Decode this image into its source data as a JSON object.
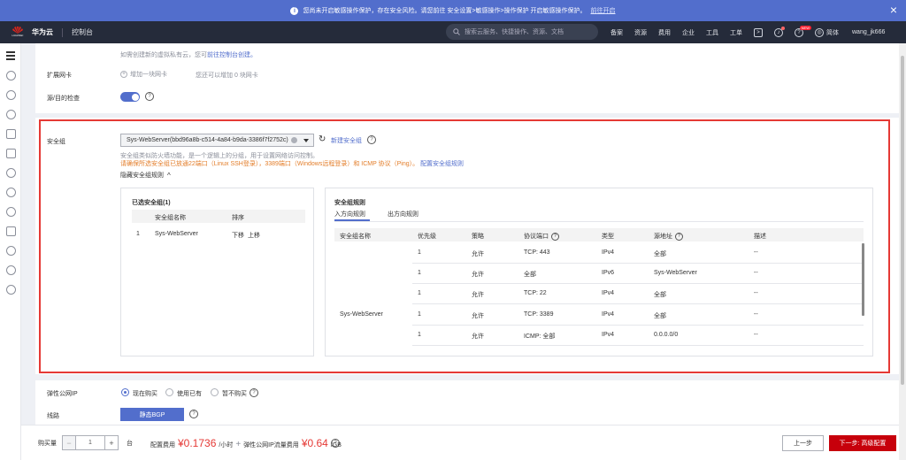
{
  "notice": {
    "text": "您尚未开启敏感操作保护，存在安全风险。请您前往 安全设置>敏感操作>操作保护 开启敏感操作保护。",
    "link": "前往开启"
  },
  "header": {
    "brand": "华为云",
    "logo_text": "HUAWEI",
    "console": "控制台",
    "search_placeholder": "搜索云服务、快捷操作、资源、文档",
    "nav": [
      "备案",
      "资源",
      "费用",
      "企业",
      "工具",
      "工单"
    ],
    "new_badge": "NEW",
    "lang": "简体",
    "user": "wang_jk666"
  },
  "form": {
    "create_tip_prefix": "如需创建新的虚拟私有云，您可",
    "create_tip_link": "前往控制台创建。",
    "ext_nic_label": "扩展网卡",
    "add_nic": "增加一块网卡",
    "add_nic_tip": "您还可以增加 0 块网卡",
    "src_dst_label": "源/目的检查",
    "sg_label": "安全组",
    "sg_value": "Sys-WebServer(bbd96a8b-c514-4a84-b9da-3386f7f2752c)",
    "new_sg": "新建安全组",
    "sg_desc": "安全组类似防火墙功能，是一个逻辑上的分组，用于设置网络访问控制。",
    "sg_warn": "请确保所选安全组已放通22端口（Linux SSH登录），3389端口（Windows远程登录）和 ICMP 协议（Ping）。",
    "sg_config": "配置安全组规则",
    "hide_rules": "隐藏安全组规则",
    "eip_label": "弹性公网IP",
    "eip_options": [
      "现在购买",
      "使用已有",
      "暂不购买"
    ],
    "line_label": "线路",
    "line_value": "静态BGP"
  },
  "selected_sg": {
    "title": "已选安全组(1)",
    "headers": [
      "安全组名称",
      "排序"
    ],
    "rows": [
      {
        "index": "1",
        "name": "Sys-WebServer",
        "down": "下移",
        "up": "上移"
      }
    ]
  },
  "rules": {
    "title": "安全组规则",
    "tabs": [
      "入方向规则",
      "出方向规则"
    ],
    "headers": [
      "安全组名称",
      "优先级",
      "策略",
      "协议端口",
      "类型",
      "源地址",
      "描述"
    ],
    "group_name": "Sys-WebServer",
    "rows": [
      {
        "priority": "1",
        "policy": "允许",
        "port": "TCP: 443",
        "type": "IPv4",
        "source": "全部",
        "desc": "--"
      },
      {
        "priority": "1",
        "policy": "允许",
        "port": "全部",
        "type": "IPv6",
        "source": "Sys-WebServer",
        "desc": "--"
      },
      {
        "priority": "1",
        "policy": "允许",
        "port": "TCP: 22",
        "type": "IPv4",
        "source": "全部",
        "desc": "--"
      },
      {
        "priority": "1",
        "policy": "允许",
        "port": "TCP: 3389",
        "type": "IPv4",
        "source": "全部",
        "desc": "--"
      },
      {
        "priority": "1",
        "policy": "允许",
        "port": "ICMP: 全部",
        "type": "IPv4",
        "source": "0.0.0.0/0",
        "desc": "--"
      }
    ]
  },
  "bottom": {
    "qty_label": "购买量",
    "qty_value": "1",
    "unit": "台",
    "fee_label": "配置费用",
    "fee_value": "¥0.1736",
    "fee_unit": "/小时",
    "plus": "+",
    "eip_fee_label": "弹性公网IP流量费用",
    "eip_fee_value": "¥0.64",
    "eip_fee_unit": "/GB",
    "prev": "上一步",
    "next": "下一步: 高级配置"
  },
  "colors": {
    "accent": "#526ecc",
    "danger": "#e53935",
    "primary_btn": "#c7000b",
    "header_bg": "#252b3a"
  }
}
